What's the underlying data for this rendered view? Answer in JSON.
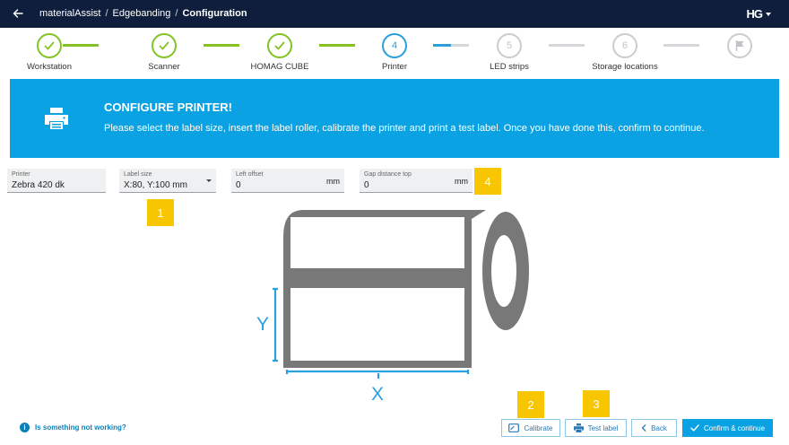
{
  "header": {
    "breadcrumb": [
      "materialAssist",
      "Edgebanding",
      "Configuration"
    ],
    "logo": "HG"
  },
  "stepper": {
    "steps": [
      {
        "label": "Workstation",
        "state": "done",
        "number": ""
      },
      {
        "label": "Scanner",
        "state": "done",
        "number": ""
      },
      {
        "label": "HOMAG CUBE",
        "state": "done",
        "number": ""
      },
      {
        "label": "Printer",
        "state": "active",
        "number": "4"
      },
      {
        "label": "LED strips",
        "state": "todo",
        "number": "5"
      },
      {
        "label": "Storage locations",
        "state": "todo",
        "number": "6"
      },
      {
        "label": "",
        "state": "todo",
        "number": ""
      }
    ],
    "colors": {
      "done": "#84c225",
      "active": "#2a9fd8",
      "todo": "#d6d8db"
    }
  },
  "banner": {
    "title": "CONFIGURE PRINTER!",
    "text": "Please select the label size, insert the label roller, calibrate the printer and print a test label. Once you have done this, confirm to continue.",
    "color": "#0ba2e3"
  },
  "form": {
    "printer": {
      "label": "Printer",
      "value": "Zebra 420 dk"
    },
    "label_size": {
      "label": "Label size",
      "value": "X:80, Y:100 mm"
    },
    "left_offset": {
      "label": "Left offset",
      "value": "0",
      "unit": "mm"
    },
    "gap_distance_top": {
      "label": "Gap distance top",
      "value": "0",
      "unit": "mm"
    }
  },
  "badges": [
    "1",
    "2",
    "3",
    "4"
  ],
  "illustration": {
    "y_label": "Y",
    "x_label": "X"
  },
  "footer": {
    "help_text": "Is something not working?",
    "calibrate": "Calibrate",
    "test_label": "Test label",
    "back": "Back",
    "confirm": "Confirm & continue"
  }
}
